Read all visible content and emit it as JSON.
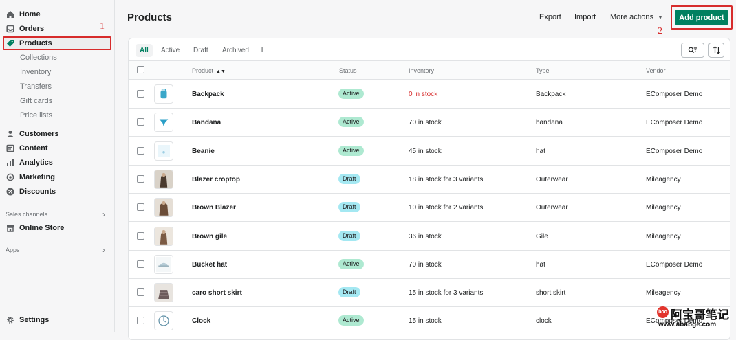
{
  "sidebar": {
    "items": [
      {
        "label": "Home",
        "icon": "home-icon"
      },
      {
        "label": "Orders",
        "icon": "inbox-icon"
      },
      {
        "label": "Products",
        "icon": "tag-icon"
      },
      {
        "label": "Customers",
        "icon": "person-icon"
      },
      {
        "label": "Content",
        "icon": "document-icon"
      },
      {
        "label": "Analytics",
        "icon": "bar-chart-icon"
      },
      {
        "label": "Marketing",
        "icon": "target-icon"
      },
      {
        "label": "Discounts",
        "icon": "discount-icon"
      },
      {
        "label": "Online Store",
        "icon": "store-icon"
      },
      {
        "label": "Settings",
        "icon": "gear-icon"
      }
    ],
    "product_subitems": [
      "Collections",
      "Inventory",
      "Transfers",
      "Gift cards",
      "Price lists"
    ],
    "sales_channels_label": "Sales channels",
    "apps_label": "Apps"
  },
  "annotations": {
    "one": "1",
    "two": "2"
  },
  "header": {
    "title": "Products",
    "export": "Export",
    "import": "Import",
    "more_actions": "More actions",
    "add_product": "Add product"
  },
  "tabs": [
    "All",
    "Active",
    "Draft",
    "Archived"
  ],
  "table": {
    "columns": [
      "Product",
      "Status",
      "Inventory",
      "Type",
      "Vendor"
    ],
    "rows": [
      {
        "name": "Backpack",
        "status": "Active",
        "inventory": "0 in stock",
        "type": "Backpack",
        "vendor": "EComposer Demo"
      },
      {
        "name": "Bandana",
        "status": "Active",
        "inventory": "70 in stock",
        "type": "bandana",
        "vendor": "EComposer Demo"
      },
      {
        "name": "Beanie",
        "status": "Active",
        "inventory": "45 in stock",
        "type": "hat",
        "vendor": "EComposer Demo"
      },
      {
        "name": "Blazer croptop",
        "status": "Draft",
        "inventory": "18 in stock for 3 variants",
        "type": "Outerwear",
        "vendor": "Mileagency"
      },
      {
        "name": "Brown Blazer",
        "status": "Draft",
        "inventory": "10 in stock for 2 variants",
        "type": "Outerwear",
        "vendor": "Mileagency"
      },
      {
        "name": "Brown gile",
        "status": "Draft",
        "inventory": "36 in stock",
        "type": "Gile",
        "vendor": "Mileagency"
      },
      {
        "name": "Bucket hat",
        "status": "Active",
        "inventory": "70 in stock",
        "type": "hat",
        "vendor": "EComposer Demo"
      },
      {
        "name": "caro short skirt",
        "status": "Draft",
        "inventory": "15 in stock for 3 variants",
        "type": "short skirt",
        "vendor": "Mileagency"
      },
      {
        "name": "Clock",
        "status": "Active",
        "inventory": "15 in stock",
        "type": "clock",
        "vendor": "EComposer Demo"
      }
    ]
  },
  "watermark": {
    "cn": "阿宝哥笔记",
    "url": "www.ababge.com",
    "logo": "boo"
  },
  "colors": {
    "accent": "#008060",
    "annotation": "#d72c2c",
    "active_badge": "#aee9d1",
    "draft_badge": "#a4e8f2"
  }
}
